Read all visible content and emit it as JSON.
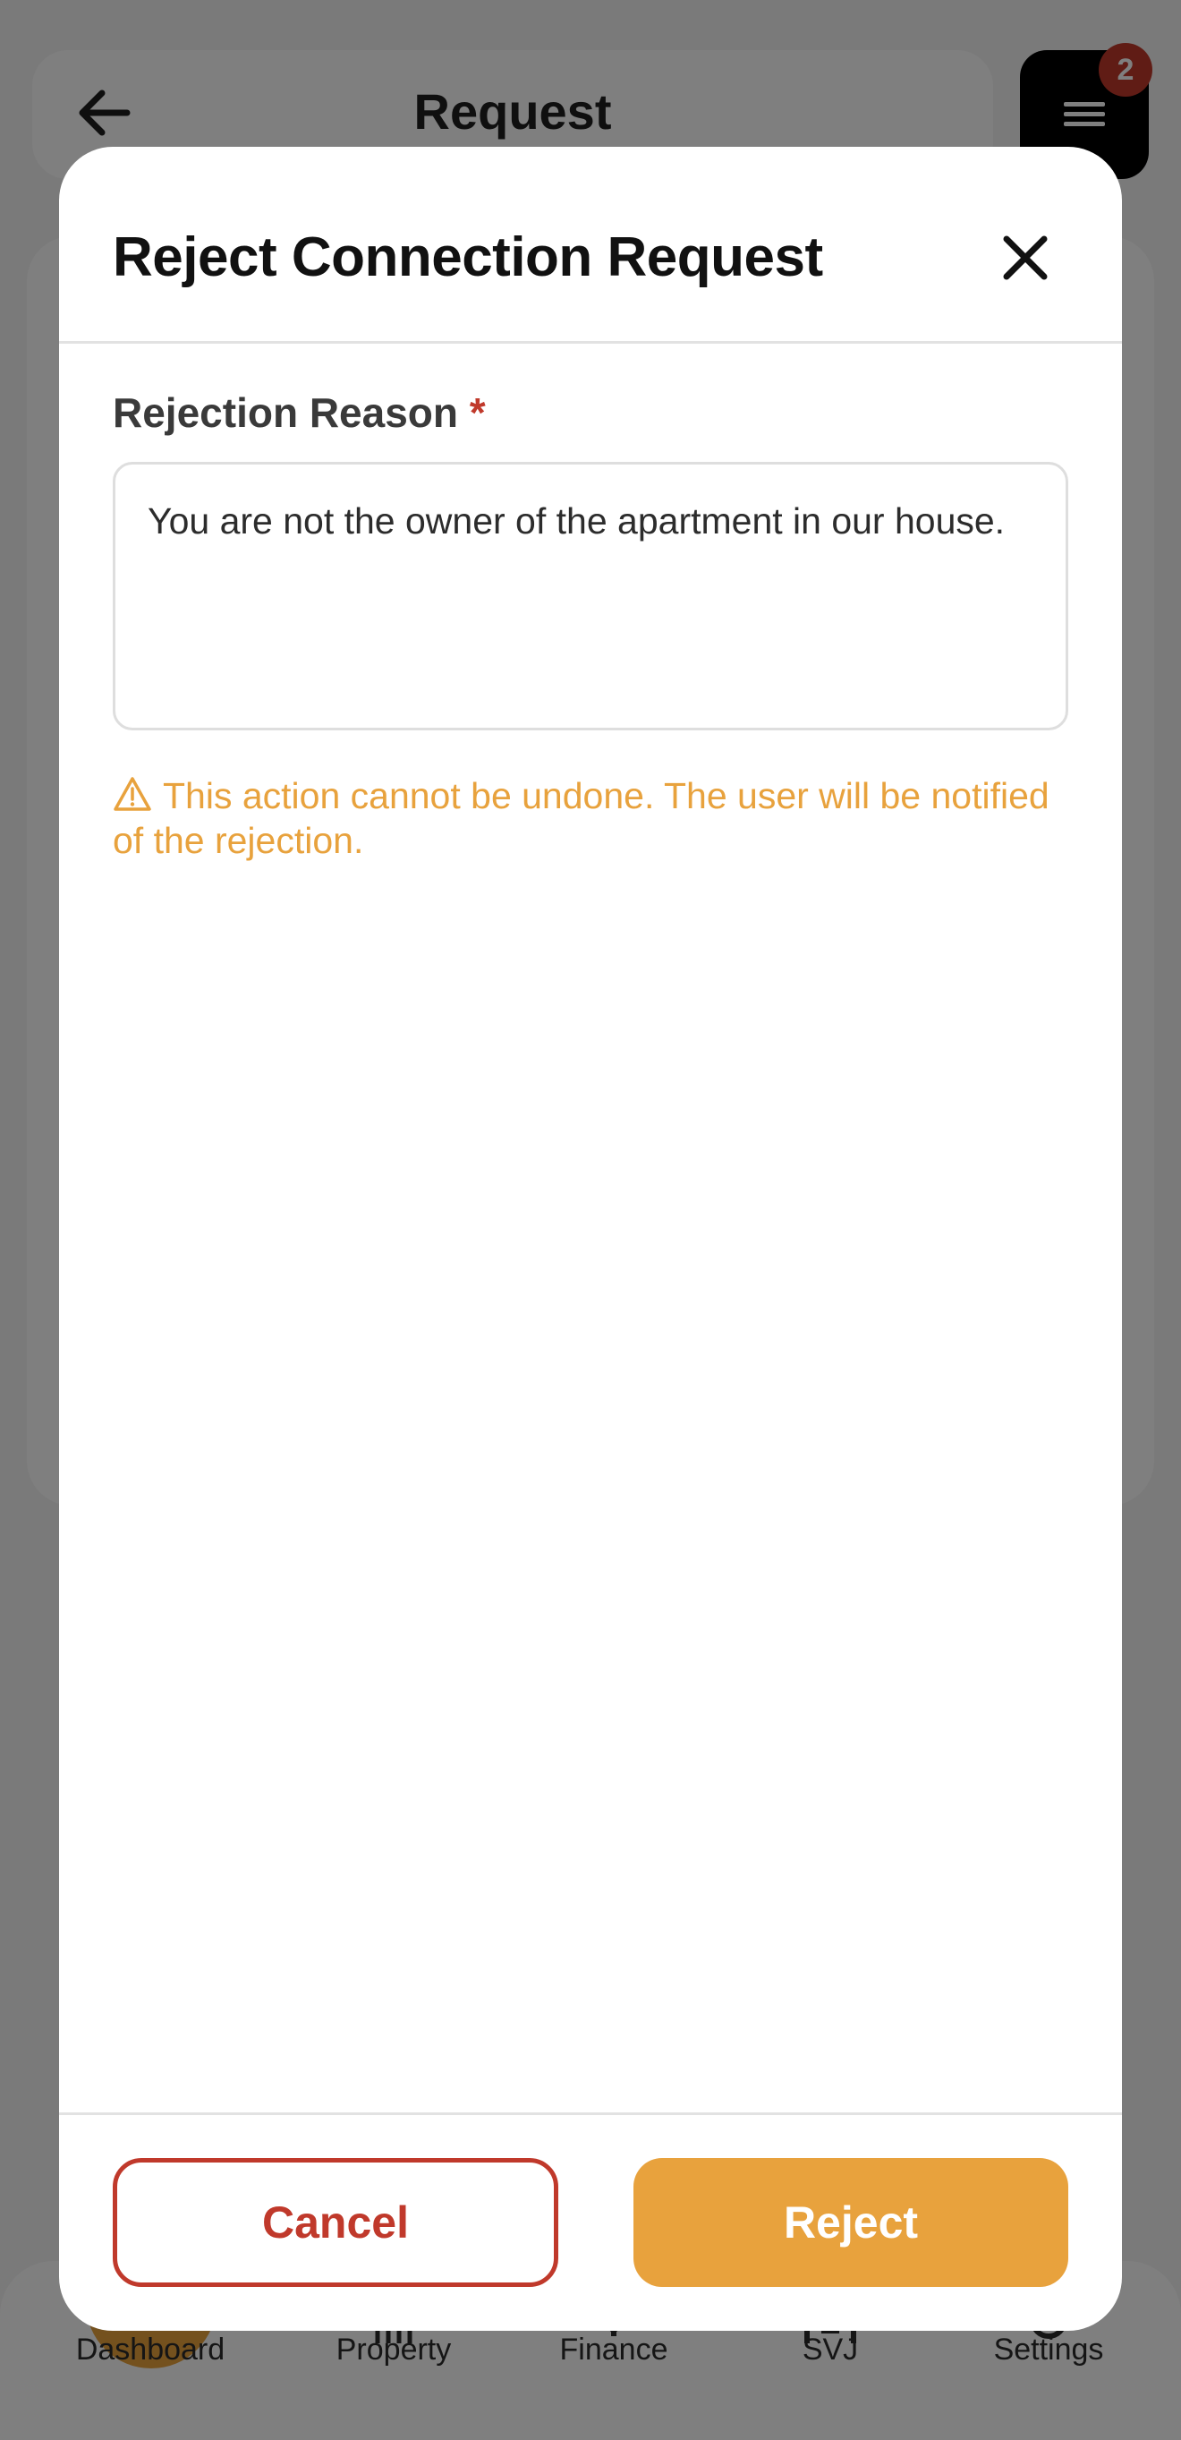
{
  "header": {
    "title": "Request",
    "notification_count": "2"
  },
  "bottom_nav": {
    "items": [
      {
        "label": "Dashboard",
        "icon": "dashboard-icon"
      },
      {
        "label": "Property",
        "icon": "building-icon"
      },
      {
        "label": "Finance",
        "icon": "finance-icon"
      },
      {
        "label": "SVJ",
        "icon": "svj-icon"
      },
      {
        "label": "Settings",
        "icon": "gear-icon"
      }
    ]
  },
  "modal": {
    "title": "Reject Connection Request",
    "reason_label": "Rejection Reason",
    "required_marker": "*",
    "reason_value": "You are not the owner of the apartment in our house.",
    "warning_text": "This action cannot be undone. The user will be notified of the rejection.",
    "cancel_label": "Cancel",
    "reject_label": "Reject"
  },
  "colors": {
    "accent": "#e8a23d",
    "danger": "#c0392b",
    "badge": "#c0392b"
  }
}
